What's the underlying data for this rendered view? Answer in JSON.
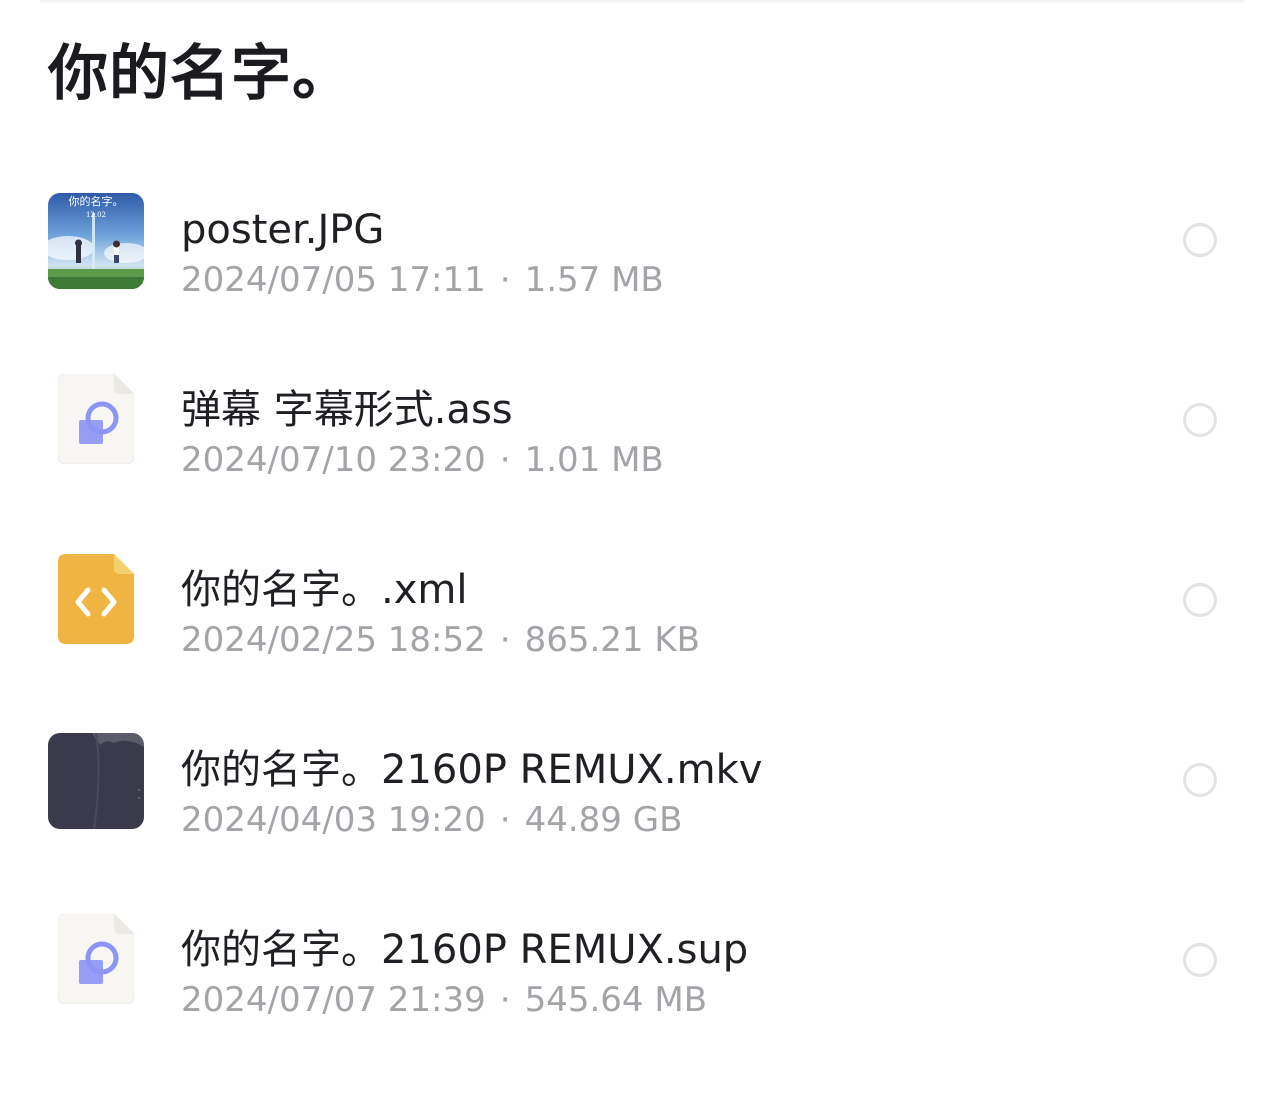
{
  "folder": {
    "title": "你的名字。"
  },
  "files": [
    {
      "name": "poster.JPG",
      "date": "2024/07/05 17:11",
      "size": "1.57 MB",
      "icon": "image-thumbnail-icon"
    },
    {
      "name": "弹幕 字幕形式.ass",
      "date": "2024/07/10 23:20",
      "size": "1.01 MB",
      "icon": "generic-file-icon"
    },
    {
      "name": "你的名字。.xml",
      "date": "2024/02/25 18:52",
      "size": "865.21 KB",
      "icon": "code-file-icon"
    },
    {
      "name": "你的名字。2160P REMUX.mkv",
      "date": "2024/04/03 19:20",
      "size": "44.89 GB",
      "icon": "video-thumbnail-icon"
    },
    {
      "name": "你的名字。2160P REMUX.sup",
      "date": "2024/07/07 21:39",
      "size": "545.64 MB",
      "icon": "generic-file-icon"
    }
  ],
  "poster_thumbnail": {
    "title": "你的名字。",
    "date": "12.02"
  },
  "meta_separator": "·",
  "colors": {
    "text_primary": "#1f1f24",
    "text_secondary": "#a3a3a8",
    "xml_icon": "#f0b442",
    "generic_icon_accent": "#8c95f5",
    "video_thumb": "#3a3a4c",
    "radio_border": "#e3e3e6"
  }
}
